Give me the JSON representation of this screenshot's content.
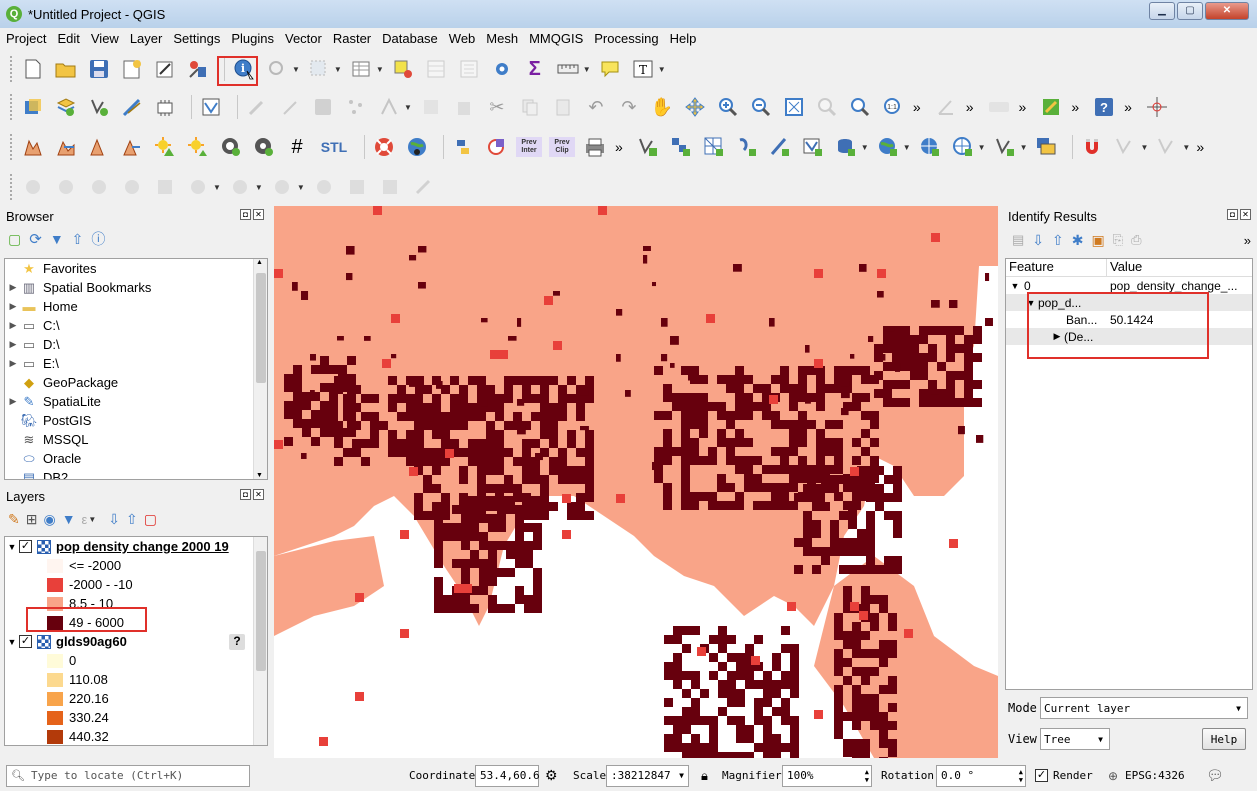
{
  "window": {
    "title": "*Untitled Project - QGIS",
    "min": "▁",
    "max": "▢",
    "close": "✕"
  },
  "menu": [
    "Project",
    "Edit",
    "View",
    "Layer",
    "Settings",
    "Plugins",
    "Vector",
    "Raster",
    "Database",
    "Web",
    "Mesh",
    "MMQGIS",
    "Processing",
    "Help"
  ],
  "toolbar_labels": {
    "stl": "STL",
    "prev_inter": "Prev Inter",
    "prev_clip": "Prev Clip",
    "more": "»"
  },
  "browser": {
    "title": "Browser",
    "items": [
      {
        "label": "Favorites",
        "icon": "star-icon",
        "expandable": false
      },
      {
        "label": "Spatial Bookmarks",
        "icon": "bookmark-icon",
        "expandable": true
      },
      {
        "label": "Home",
        "icon": "folder-icon",
        "expandable": true
      },
      {
        "label": "C:\\",
        "icon": "drive-icon",
        "expandable": true
      },
      {
        "label": "D:\\",
        "icon": "drive-icon",
        "expandable": true
      },
      {
        "label": "E:\\",
        "icon": "drive-icon",
        "expandable": true
      },
      {
        "label": "GeoPackage",
        "icon": "geopackage-icon",
        "expandable": false
      },
      {
        "label": "SpatiaLite",
        "icon": "spatialite-icon",
        "expandable": true
      },
      {
        "label": "PostGIS",
        "icon": "postgis-icon",
        "expandable": false
      },
      {
        "label": "MSSQL",
        "icon": "mssql-icon",
        "expandable": false
      },
      {
        "label": "Oracle",
        "icon": "oracle-icon",
        "expandable": false
      },
      {
        "label": "DB2",
        "icon": "db2-icon",
        "expandable": false
      }
    ]
  },
  "layers": {
    "title": "Layers",
    "layer1": {
      "name": "pop density change 2000 19",
      "checked": true,
      "classes": [
        {
          "label": "<= -2000",
          "color": "#fff5f0"
        },
        {
          "label": "-2000 - -10",
          "color": "#e8403a"
        },
        {
          "label": "8.5 - 10",
          "color": "#f9a488"
        },
        {
          "label": "49 - 6000",
          "color": "#67000d"
        }
      ]
    },
    "layer2": {
      "name": "glds90ag60",
      "checked": true,
      "help": "?",
      "classes": [
        {
          "label": "0",
          "color": "#fffbd9"
        },
        {
          "label": "110.08",
          "color": "#fcd98f"
        },
        {
          "label": "220.16",
          "color": "#f8a44b"
        },
        {
          "label": "330.24",
          "color": "#e5631a"
        },
        {
          "label": "440.32",
          "color": "#b33a0a"
        }
      ]
    }
  },
  "identify": {
    "title": "Identify Results",
    "col_feature": "Feature",
    "col_value": "Value",
    "rows": [
      {
        "feature": "0",
        "value": "pop_density_change_..."
      },
      {
        "feature": "pop_d...",
        "value": ""
      },
      {
        "feature": "Ban...",
        "value": "50.1424"
      },
      {
        "feature": "(De...",
        "value": ""
      }
    ],
    "mode_label": "Mode",
    "mode_value": "Current layer",
    "view_label": "View",
    "view_value": "Tree",
    "help_button": "Help"
  },
  "status": {
    "locate_placeholder": "Type to locate (Ctrl+K)",
    "coordinate_label": "Coordinate",
    "coordinate_value": "53.4,60.6",
    "scale_label": "Scale",
    "scale_value": ":38212847",
    "magnifier_label": "Magnifier",
    "magnifier_value": "100%",
    "rotation_label": "Rotation",
    "rotation_value": "0.0 °",
    "render_label": "Render",
    "render_checked": true,
    "crs": "EPSG:4326"
  },
  "colors": {
    "accent_red": "#e0302a",
    "class_light": "#f9a488",
    "class_red": "#e8403a",
    "class_dark": "#67000d"
  }
}
